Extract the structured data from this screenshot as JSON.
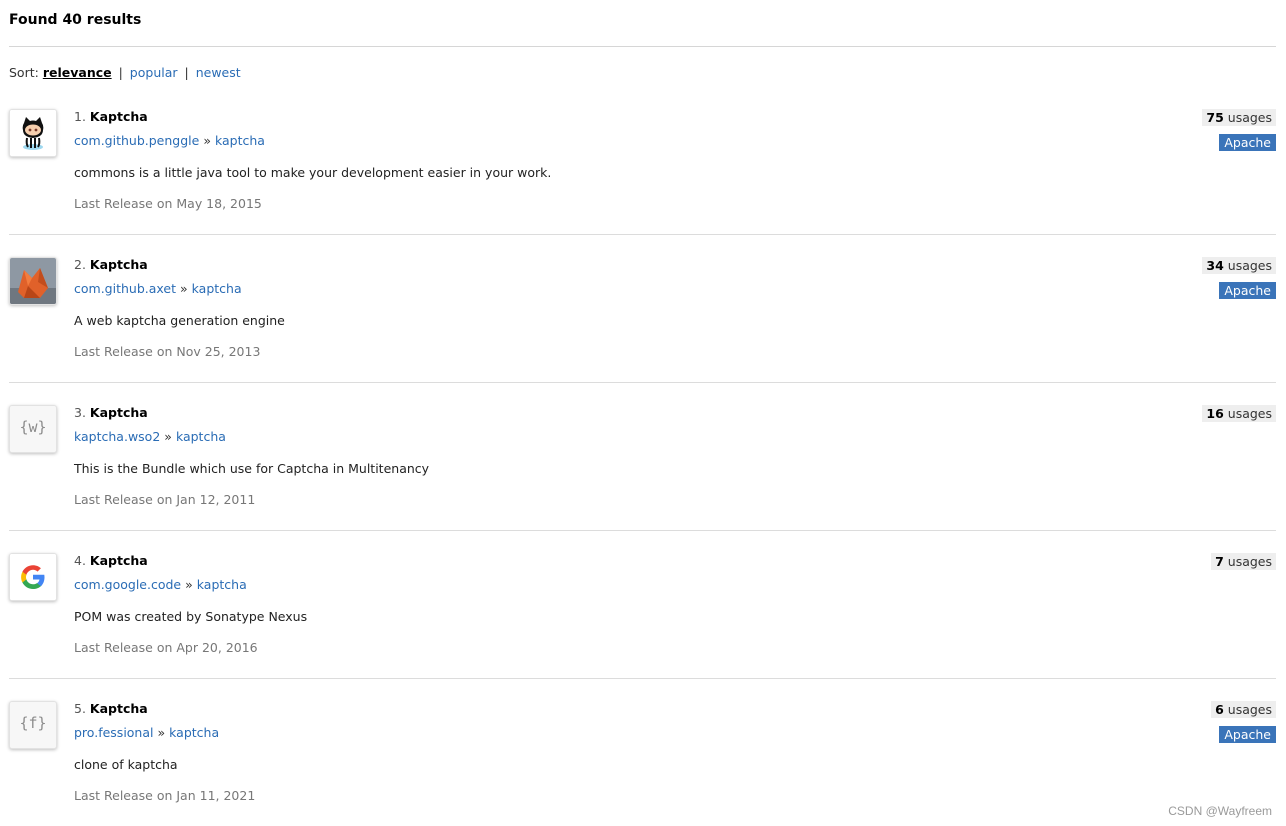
{
  "header": {
    "results_text": "Found 40 results"
  },
  "sort": {
    "label": "Sort:",
    "active": "relevance",
    "separator": "|",
    "options": [
      "popular",
      "newest"
    ]
  },
  "results": [
    {
      "number": "1.",
      "name": "Kaptcha",
      "group": "com.github.penggle",
      "separator": "»",
      "artifact": "kaptcha",
      "description": "commons is a little java tool to make your development easier in your work.",
      "release": "Last Release on May 18, 2015",
      "usages_count": "75",
      "usages_label": "usages",
      "license": "Apache",
      "logo": "github-octocat-icon"
    },
    {
      "number": "2.",
      "name": "Kaptcha",
      "group": "com.github.axet",
      "separator": "»",
      "artifact": "kaptcha",
      "description": "A web kaptcha generation engine",
      "release": "Last Release on Nov 25, 2013",
      "usages_count": "34",
      "usages_label": "usages",
      "license": "Apache",
      "logo": "orange-fox-avatar-icon"
    },
    {
      "number": "3.",
      "name": "Kaptcha",
      "group": "kaptcha.wso2",
      "separator": "»",
      "artifact": "kaptcha",
      "description": "This is the Bundle which use for Captcha in Multitenancy",
      "release": "Last Release on Jan 12, 2011",
      "usages_count": "16",
      "usages_label": "usages",
      "license": "",
      "logo": "w-brace-icon",
      "logo_text": "{w}"
    },
    {
      "number": "4.",
      "name": "Kaptcha",
      "group": "com.google.code",
      "separator": "»",
      "artifact": "kaptcha",
      "description": "POM was created by Sonatype Nexus",
      "release": "Last Release on Apr 20, 2016",
      "usages_count": "7",
      "usages_label": "usages",
      "license": "",
      "logo": "google-g-icon"
    },
    {
      "number": "5.",
      "name": "Kaptcha",
      "group": "pro.fessional",
      "separator": "»",
      "artifact": "kaptcha",
      "description": "clone of kaptcha",
      "release": "Last Release on Jan 11, 2021",
      "usages_count": "6",
      "usages_label": "usages",
      "license": "Apache",
      "logo": "f-brace-icon",
      "logo_text": "{f}"
    }
  ],
  "watermark": "CSDN @Wayfreem",
  "colors": {
    "link": "#2a6cb5",
    "license_badge": "#3a74b9",
    "usages_badge": "#eeeeee"
  }
}
